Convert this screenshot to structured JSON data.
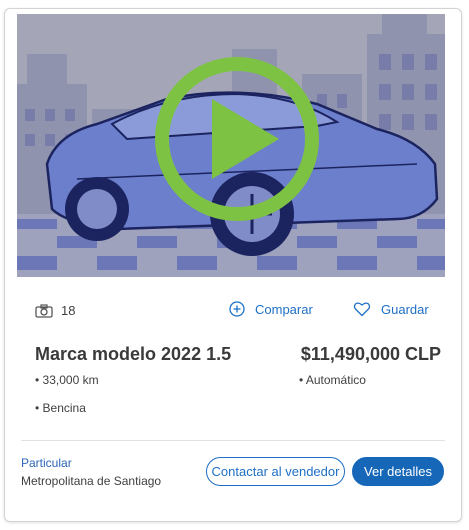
{
  "listing": {
    "photo_count": "18",
    "compare_label": "Comparar",
    "save_label": "Guardar",
    "title": "Marca modelo 2022 1.5",
    "price": "$11,490,000 CLP",
    "specs": {
      "mileage": "• 33,000 km",
      "transmission": "• Automático",
      "fuel": "• Bencina"
    },
    "seller": {
      "type": "Particular",
      "location": "Metropolitana de Santiago"
    },
    "contact_label": "Contactar al vendedor",
    "details_label": "Ver detalles"
  },
  "icons": {
    "camera": "camera-icon",
    "compare": "plus-circle-icon",
    "save": "heart-icon",
    "play": "play-icon"
  },
  "colors": {
    "accent_blue": "#1f6fc5",
    "button_blue": "#1767b8",
    "play_green": "#7ec243",
    "image_tint": "#6b7bc1"
  }
}
